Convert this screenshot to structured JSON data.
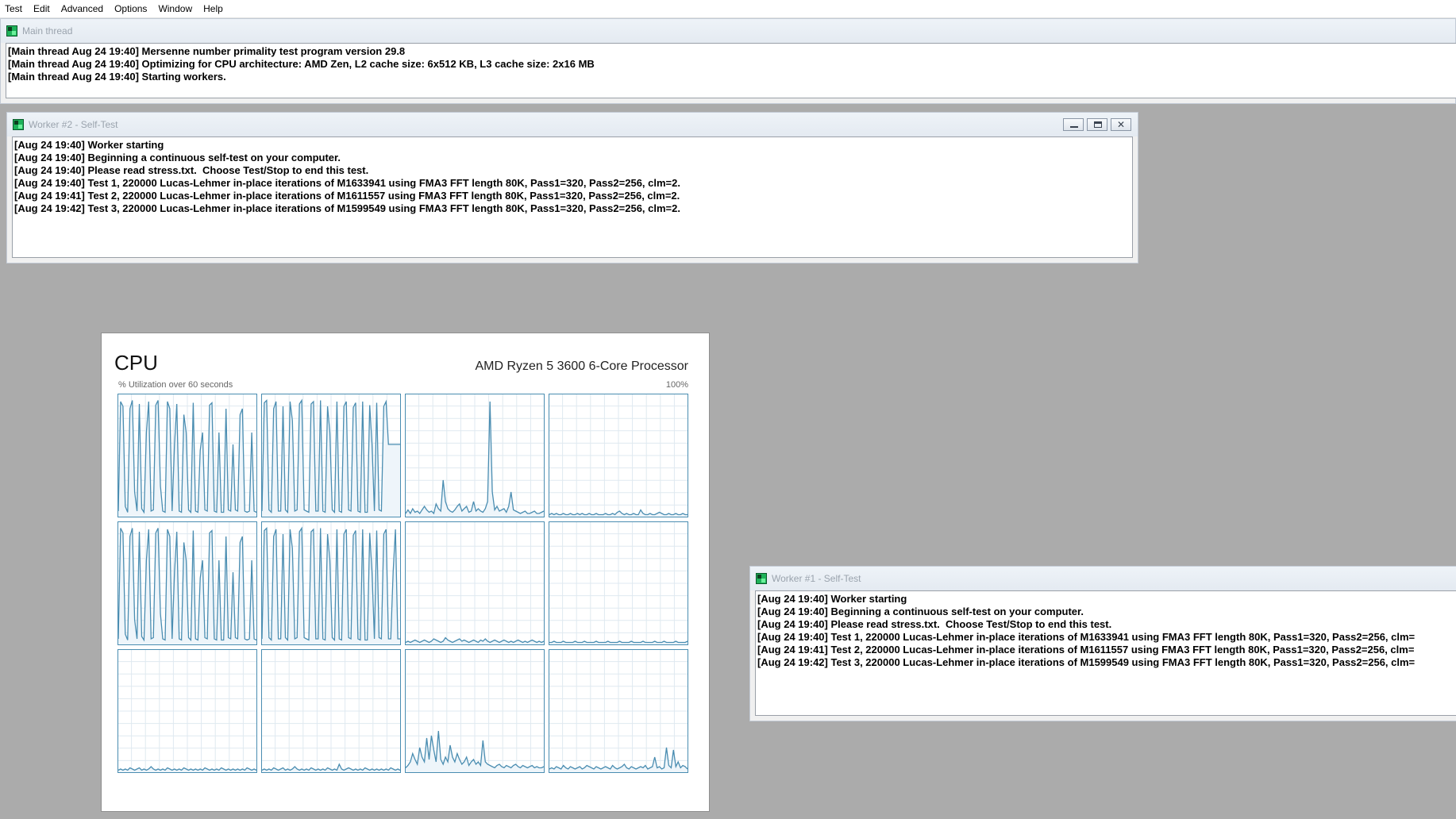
{
  "menu": [
    "Test",
    "Edit",
    "Advanced",
    "Options",
    "Window",
    "Help"
  ],
  "main_window": {
    "title": "Main thread",
    "lines": [
      "[Main thread Aug 24 19:40] Mersenne number primality test program version 29.8",
      "[Main thread Aug 24 19:40] Optimizing for CPU architecture: AMD Zen, L2 cache size: 6x512 KB, L3 cache size: 2x16 MB",
      "[Main thread Aug 24 19:40] Starting workers."
    ]
  },
  "worker2": {
    "title": "Worker #2 - Self-Test",
    "lines": [
      "[Aug 24 19:40] Worker starting",
      "[Aug 24 19:40] Beginning a continuous self-test on your computer.",
      "[Aug 24 19:40] Please read stress.txt.  Choose Test/Stop to end this test.",
      "[Aug 24 19:40] Test 1, 220000 Lucas-Lehmer in-place iterations of M1633941 using FMA3 FFT length 80K, Pass1=320, Pass2=256, clm=2.",
      "[Aug 24 19:41] Test 2, 220000 Lucas-Lehmer in-place iterations of M1611557 using FMA3 FFT length 80K, Pass1=320, Pass2=256, clm=2.",
      "[Aug 24 19:42] Test 3, 220000 Lucas-Lehmer in-place iterations of M1599549 using FMA3 FFT length 80K, Pass1=320, Pass2=256, clm=2."
    ]
  },
  "worker1": {
    "title": "Worker #1 - Self-Test",
    "lines": [
      "[Aug 24 19:40] Worker starting",
      "[Aug 24 19:40] Beginning a continuous self-test on your computer.",
      "[Aug 24 19:40] Please read stress.txt.  Choose Test/Stop to end this test.",
      "[Aug 24 19:40] Test 1, 220000 Lucas-Lehmer in-place iterations of M1633941 using FMA3 FFT length 80K, Pass1=320, Pass2=256, clm=",
      "[Aug 24 19:41] Test 2, 220000 Lucas-Lehmer in-place iterations of M1611557 using FMA3 FFT length 80K, Pass1=320, Pass2=256, clm=",
      "[Aug 24 19:42] Test 3, 220000 Lucas-Lehmer in-place iterations of M1599549 using FMA3 FFT length 80K, Pass1=320, Pass2=256, clm="
    ]
  },
  "cpu": {
    "title": "CPU",
    "processor": "AMD Ryzen 5 3600 6-Core Processor",
    "util_label": "% Utilization over 60 seconds",
    "max_label": "100%",
    "colors": {
      "line": "#4a8db1",
      "fill": "#eef5fa",
      "grid": "#dfe9f0",
      "border": "#4a8db1"
    },
    "cores": [
      [
        4,
        96,
        92,
        8,
        3,
        90,
        97,
        20,
        4,
        94,
        6,
        3,
        70,
        96,
        4,
        5,
        93,
        97,
        25,
        4,
        3,
        96,
        90,
        4,
        60,
        94,
        4,
        3,
        85,
        70,
        5,
        3,
        95,
        4,
        3,
        55,
        70,
        5,
        4,
        93,
        95,
        4,
        3,
        70,
        3,
        3,
        90,
        5,
        4,
        60,
        5,
        4,
        85,
        90,
        4,
        3,
        4,
        70,
        4,
        3
      ],
      [
        4,
        95,
        97,
        5,
        3,
        90,
        96,
        4,
        4,
        92,
        5,
        3,
        96,
        80,
        4,
        5,
        94,
        97,
        5,
        4,
        3,
        94,
        96,
        4,
        4,
        97,
        4,
        3,
        92,
        70,
        5,
        3,
        96,
        4,
        3,
        92,
        96,
        5,
        4,
        91,
        95,
        4,
        3,
        96,
        3,
        3,
        93,
        60,
        4,
        95,
        5,
        4,
        92,
        96,
        60,
        60,
        60,
        60,
        60,
        60
      ],
      [
        2,
        5,
        2,
        6,
        3,
        4,
        2,
        5,
        8,
        5,
        3,
        4,
        2,
        10,
        6,
        4,
        30,
        12,
        6,
        4,
        3,
        5,
        8,
        10,
        4,
        6,
        8,
        3,
        4,
        12,
        4,
        6,
        4,
        3,
        6,
        12,
        96,
        20,
        5,
        8,
        4,
        5,
        6,
        3,
        8,
        20,
        5,
        4,
        3,
        2,
        3,
        4,
        2,
        2,
        3,
        4,
        2,
        2,
        3,
        4
      ],
      [
        1,
        2,
        1,
        2,
        1,
        1,
        2,
        1,
        1,
        2,
        1,
        1,
        2,
        1,
        2,
        1,
        1,
        2,
        1,
        1,
        2,
        1,
        1,
        1,
        2,
        1,
        1,
        2,
        1,
        3,
        4,
        2,
        1,
        2,
        1,
        1,
        2,
        1,
        1,
        5,
        2,
        1,
        1,
        2,
        1,
        1,
        2,
        3,
        2,
        1,
        1,
        2,
        1,
        1,
        2,
        1,
        1,
        2,
        1,
        1
      ],
      [
        4,
        97,
        93,
        8,
        3,
        90,
        97,
        20,
        4,
        94,
        6,
        3,
        70,
        96,
        4,
        5,
        93,
        97,
        25,
        4,
        3,
        96,
        90,
        4,
        60,
        94,
        4,
        3,
        85,
        70,
        5,
        3,
        95,
        4,
        3,
        55,
        70,
        5,
        4,
        93,
        95,
        4,
        3,
        70,
        3,
        3,
        90,
        5,
        4,
        60,
        5,
        4,
        85,
        90,
        4,
        3,
        4,
        70,
        4,
        3
      ],
      [
        4,
        95,
        97,
        5,
        3,
        90,
        96,
        4,
        4,
        92,
        5,
        3,
        96,
        80,
        4,
        5,
        94,
        97,
        5,
        4,
        3,
        94,
        96,
        4,
        4,
        97,
        4,
        3,
        92,
        70,
        5,
        3,
        96,
        4,
        3,
        92,
        96,
        5,
        4,
        91,
        95,
        4,
        3,
        96,
        3,
        3,
        93,
        60,
        4,
        95,
        5,
        4,
        92,
        96,
        4,
        4,
        60,
        96,
        4,
        4
      ],
      [
        1,
        2,
        1,
        2,
        3,
        2,
        1,
        2,
        3,
        2,
        1,
        2,
        4,
        3,
        2,
        1,
        2,
        5,
        3,
        2,
        1,
        2,
        3,
        4,
        2,
        3,
        2,
        1,
        2,
        3,
        2,
        1,
        3,
        2,
        4,
        2,
        1,
        2,
        3,
        2,
        1,
        2,
        3,
        2,
        1,
        2,
        1,
        2,
        3,
        2,
        1,
        2,
        1,
        2,
        3,
        2,
        1,
        2,
        1,
        2
      ],
      [
        1,
        1,
        2,
        1,
        1,
        1,
        2,
        1,
        1,
        1,
        1,
        2,
        1,
        1,
        1,
        2,
        1,
        1,
        1,
        1,
        2,
        1,
        1,
        1,
        1,
        2,
        1,
        1,
        1,
        1,
        2,
        1,
        1,
        1,
        1,
        2,
        1,
        1,
        1,
        1,
        2,
        1,
        1,
        1,
        1,
        2,
        1,
        1,
        1,
        2,
        1,
        1,
        1,
        1,
        2,
        1,
        1,
        1,
        1,
        2
      ],
      [
        1,
        2,
        1,
        2,
        1,
        3,
        2,
        1,
        2,
        3,
        1,
        2,
        1,
        2,
        4,
        2,
        1,
        2,
        1,
        2,
        1,
        3,
        2,
        1,
        2,
        1,
        2,
        1,
        3,
        2,
        1,
        2,
        1,
        2,
        1,
        2,
        1,
        3,
        2,
        1,
        2,
        1,
        2,
        1,
        3,
        2,
        1,
        2,
        1,
        2,
        1,
        2,
        1,
        2,
        1,
        3,
        2,
        1,
        2,
        1
      ],
      [
        1,
        2,
        1,
        2,
        1,
        3,
        2,
        1,
        2,
        3,
        1,
        2,
        1,
        2,
        4,
        2,
        1,
        2,
        1,
        2,
        1,
        3,
        2,
        1,
        2,
        1,
        2,
        1,
        3,
        2,
        1,
        2,
        1,
        6,
        2,
        1,
        2,
        3,
        2,
        1,
        2,
        1,
        2,
        1,
        3,
        2,
        1,
        2,
        1,
        2,
        1,
        2,
        1,
        2,
        1,
        3,
        2,
        1,
        2,
        1
      ],
      [
        3,
        5,
        8,
        15,
        10,
        6,
        20,
        12,
        8,
        28,
        10,
        30,
        18,
        8,
        34,
        10,
        6,
        12,
        8,
        22,
        12,
        8,
        15,
        10,
        6,
        8,
        12,
        5,
        8,
        10,
        6,
        8,
        5,
        26,
        8,
        6,
        5,
        4,
        3,
        5,
        6,
        4,
        3,
        5,
        4,
        3,
        5,
        6,
        4,
        3,
        5,
        4,
        3,
        4,
        5,
        3,
        4,
        3,
        3,
        4
      ],
      [
        2,
        3,
        2,
        4,
        3,
        2,
        5,
        3,
        2,
        4,
        3,
        2,
        3,
        4,
        2,
        3,
        5,
        4,
        3,
        2,
        4,
        3,
        2,
        3,
        4,
        3,
        2,
        5,
        3,
        2,
        3,
        4,
        6,
        3,
        2,
        4,
        3,
        2,
        3,
        4,
        3,
        5,
        2,
        3,
        4,
        12,
        3,
        4,
        2,
        3,
        20,
        5,
        3,
        18,
        4,
        8,
        3,
        5,
        4,
        2
      ]
    ]
  }
}
